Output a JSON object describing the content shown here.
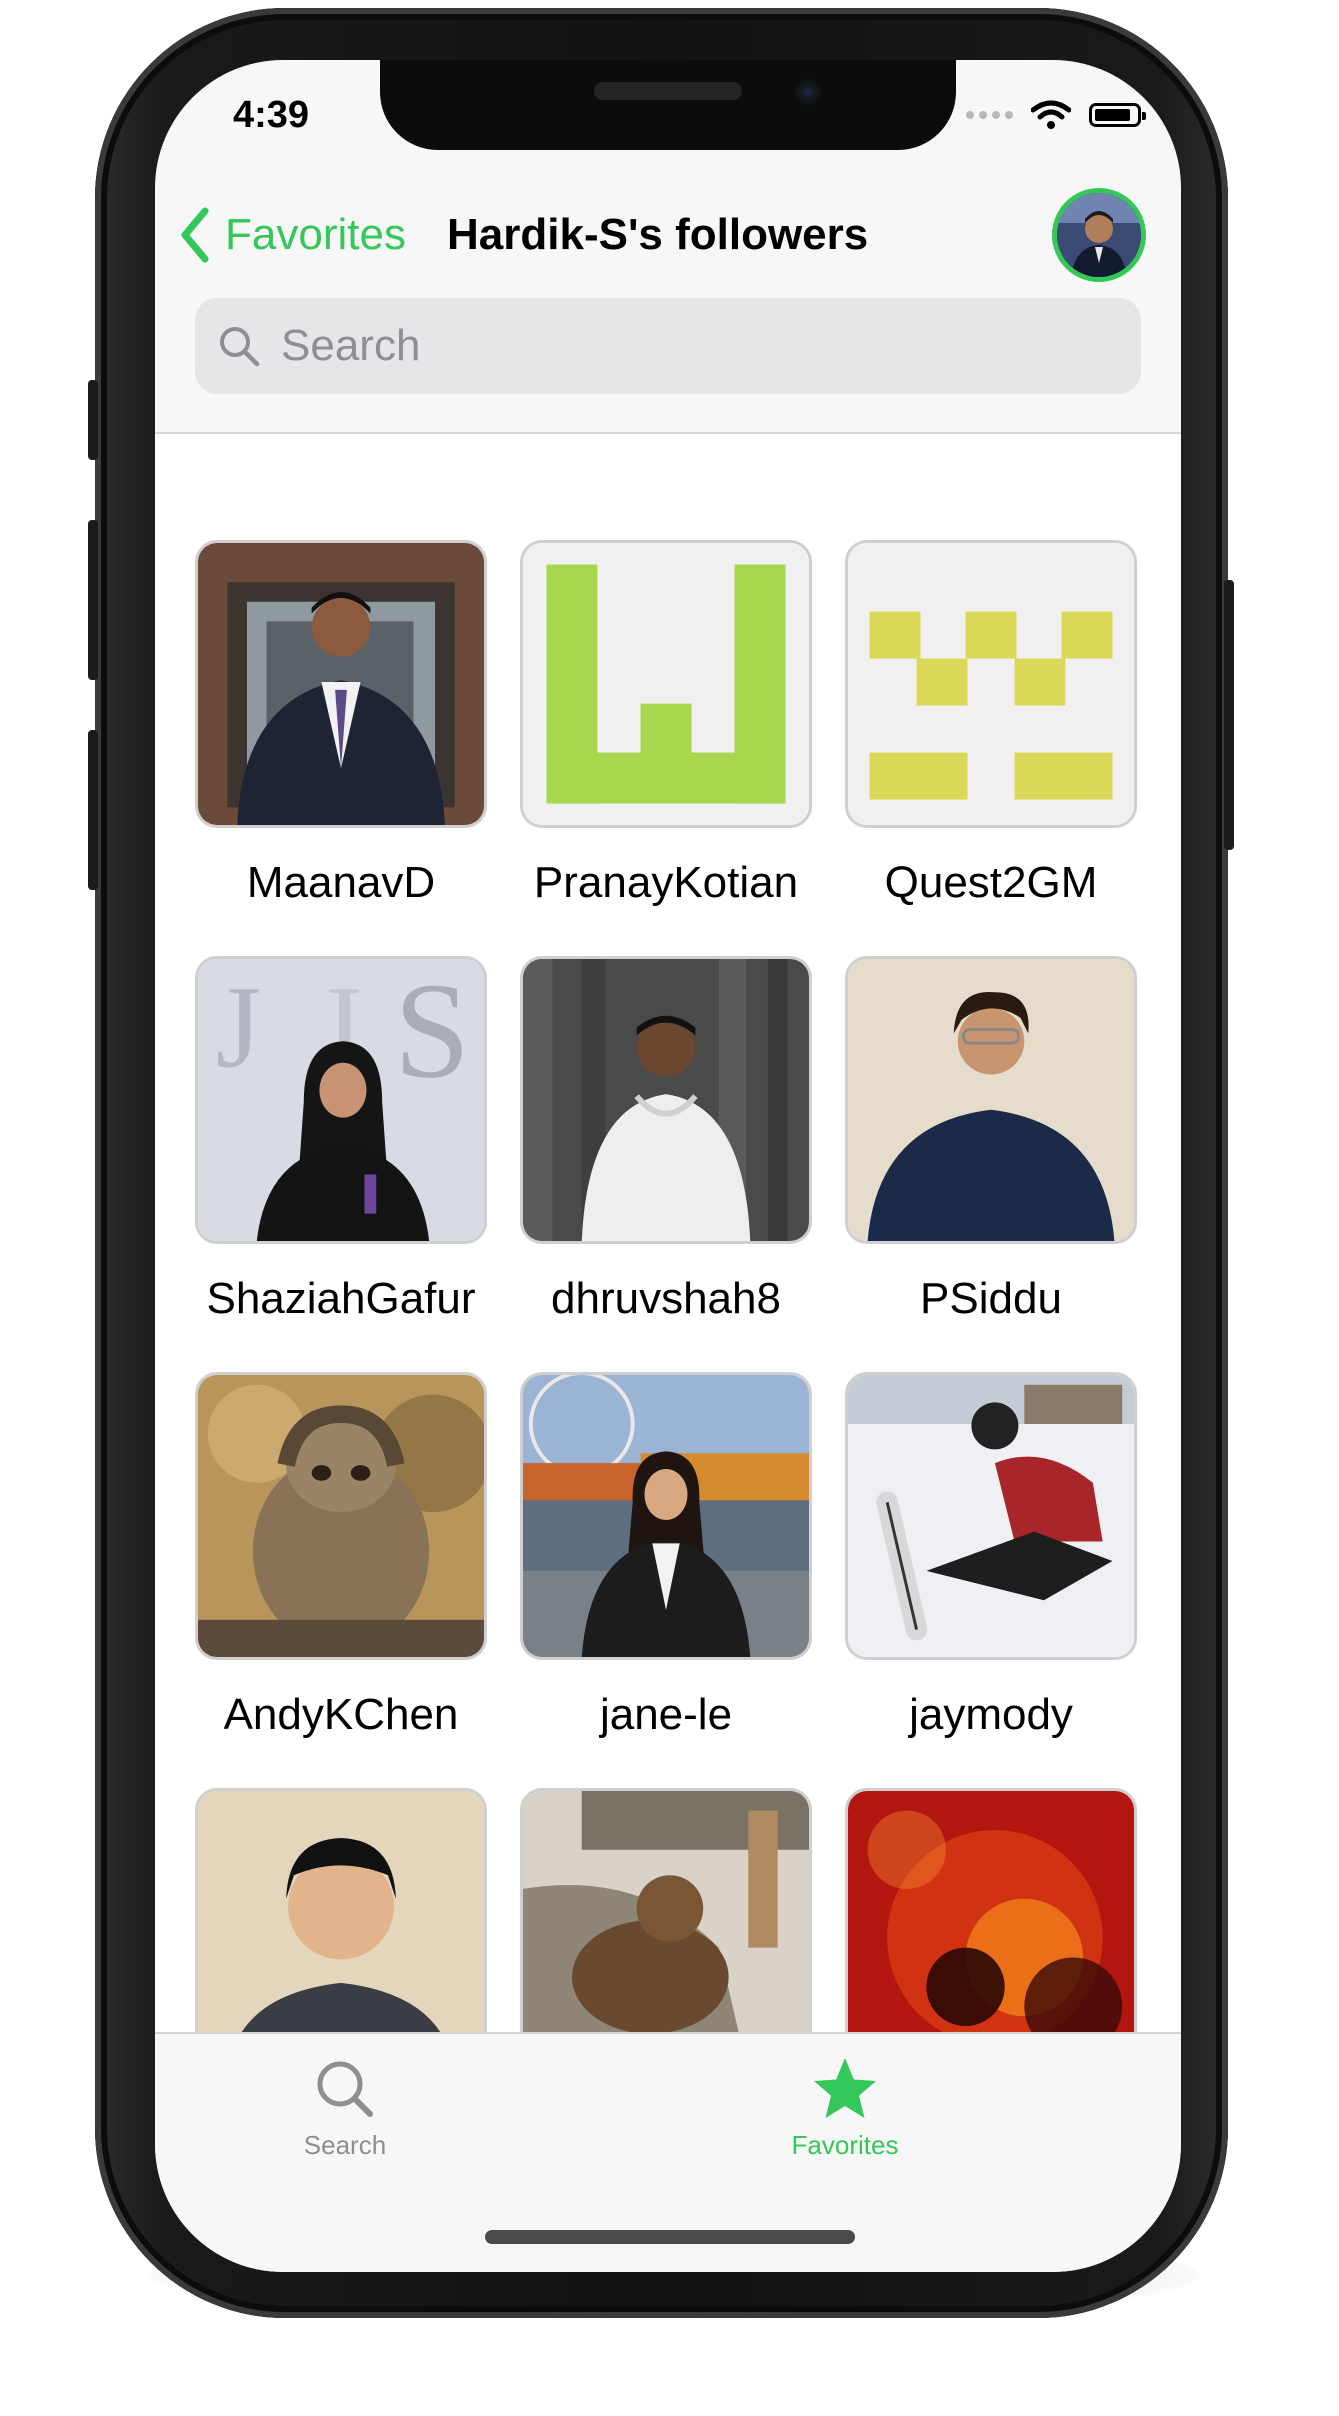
{
  "status_bar": {
    "time": "4:39"
  },
  "nav": {
    "back_label": "Favorites",
    "title": "Hardik-S's followers"
  },
  "search": {
    "placeholder": "Search",
    "value": ""
  },
  "followers": [
    {
      "username": "MaanavD"
    },
    {
      "username": "PranayKotian"
    },
    {
      "username": "Quest2GM"
    },
    {
      "username": "ShaziahGafur"
    },
    {
      "username": "dhruvshah8"
    },
    {
      "username": "PSiddu"
    },
    {
      "username": "AndyKChen"
    },
    {
      "username": "jane-le"
    },
    {
      "username": "jaymody"
    },
    {
      "username": ""
    },
    {
      "username": ""
    },
    {
      "username": ""
    }
  ],
  "tabs": [
    {
      "label": "Search",
      "icon": "magnifying-glass-icon",
      "selected": false
    },
    {
      "label": "Favorites",
      "icon": "star-icon",
      "selected": true
    }
  ],
  "colors": {
    "accent": "#34c759",
    "inactive": "#8e8e93"
  }
}
